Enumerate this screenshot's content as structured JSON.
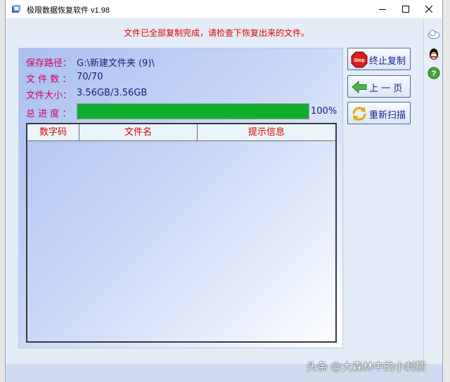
{
  "window": {
    "title": "极限数据恢复软件 v1.98"
  },
  "status_message": "文件已全部复制完成，请检查下恢复出来的文件。",
  "info": {
    "save_path_label": "保存路径：",
    "save_path_value": "G:\\新建文件夹 (9)\\",
    "file_count_label": "文 件 数 ：",
    "file_count_value": "70/70",
    "file_size_label": "文件大小：",
    "file_size_value": "3.56GB/3.56GB",
    "progress_label": "总 进 度 ：",
    "progress_value": 1.0,
    "progress_text": "100%"
  },
  "table": {
    "columns": [
      "数字码",
      "文件名",
      "提示信息"
    ],
    "rows": []
  },
  "buttons": {
    "stop_copy": "终止复制",
    "previous": "上 一 页",
    "rescan": "重新扫描"
  },
  "icons": {
    "stop": "stop-sign-icon",
    "back": "arrow-left-icon",
    "rescan": "refresh-icon"
  },
  "colors": {
    "progress": "#10ad2c",
    "status_text": "#e00000",
    "label_text": "#d4005a"
  },
  "watermark": "头条 @大森林中的小刺猬"
}
